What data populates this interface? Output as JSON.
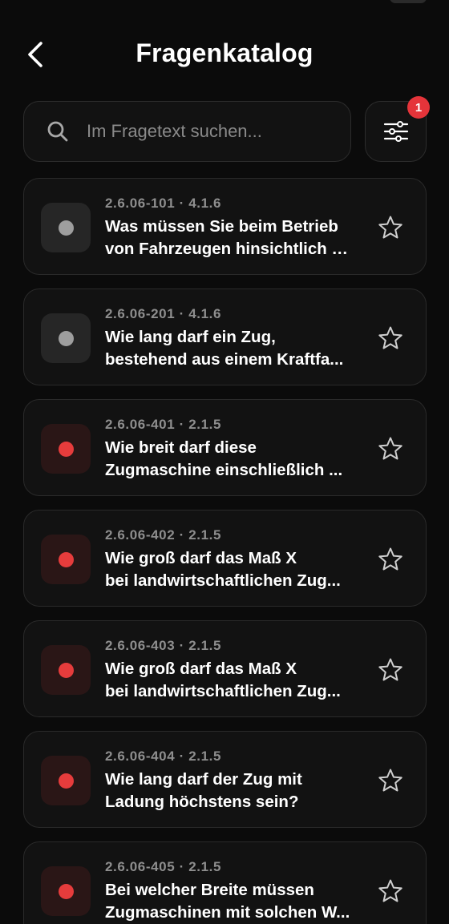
{
  "header": {
    "title": "Fragenkatalog"
  },
  "search": {
    "placeholder": "Im Fragetext suchen..."
  },
  "filter": {
    "badge_count": "1"
  },
  "colors": {
    "background": "#0b0b0b",
    "card": "#121212",
    "badge": "#e5343a",
    "status_red": "#e63c3c",
    "status_grey": "#9e9e9e"
  },
  "questions": [
    {
      "meta": "2.6.06-101 · 4.1.6",
      "line1": "Was müssen Sie beim Betrieb",
      "line2": "von Fahrzeugen hinsichtlich d...",
      "status": "grey",
      "starred": false
    },
    {
      "meta": "2.6.06-201 · 4.1.6",
      "line1": "Wie lang darf ein Zug,",
      "line2": "bestehend aus einem Kraftfa...",
      "status": "grey",
      "starred": false
    },
    {
      "meta": "2.6.06-401 · 2.1.5",
      "line1": "Wie breit darf diese",
      "line2": "Zugmaschine einschließlich ...",
      "status": "red",
      "starred": false
    },
    {
      "meta": "2.6.06-402 · 2.1.5",
      "line1": "Wie groß darf das Maß X",
      "line2": "bei landwirtschaftlichen Zug...",
      "status": "red",
      "starred": false
    },
    {
      "meta": "2.6.06-403 · 2.1.5",
      "line1": "Wie groß darf das Maß X",
      "line2": "bei landwirtschaftlichen Zug...",
      "status": "red",
      "starred": false
    },
    {
      "meta": "2.6.06-404 · 2.1.5",
      "line1": "Wie lang darf der Zug mit",
      "line2": "Ladung höchstens sein?",
      "status": "red",
      "starred": false
    },
    {
      "meta": "2.6.06-405 · 2.1.5",
      "line1": "Bei welcher Breite müssen",
      "line2": "Zugmaschinen mit solchen W...",
      "status": "red",
      "starred": false
    }
  ]
}
